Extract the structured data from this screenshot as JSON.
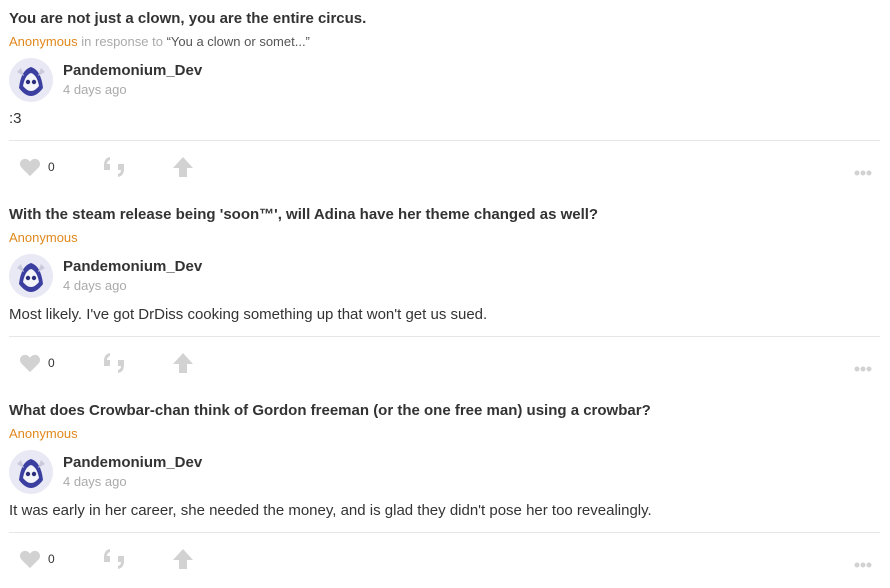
{
  "posts": [
    {
      "question": "You are not just a clown, you are the entire circus.",
      "asker": "Anonymous",
      "in_response_to": "in response to",
      "quote": "“You a clown or somet...”",
      "author": "Pandemonium_Dev",
      "time": "4 days ago",
      "answer": ":3",
      "likes": "0"
    },
    {
      "question": "With the steam release being 'soon™', will Adina have her theme changed as well?",
      "asker": "Anonymous",
      "author": "Pandemonium_Dev",
      "time": "4 days ago",
      "answer": "Most likely. I've got DrDiss cooking something up that won't get us sued.",
      "likes": "0"
    },
    {
      "question": "What does Crowbar-chan think of Gordon freeman (or the one free man) using a crowbar?",
      "asker": "Anonymous",
      "author": "Pandemonium_Dev",
      "time": "4 days ago",
      "answer": "It was early in her career, she needed the money, and is glad they didn't pose her too revealingly.",
      "likes": "0"
    }
  ],
  "icons": {
    "like": "heart-icon",
    "quote": "quote-icon",
    "share": "arrow-up-icon",
    "more": "more-dots-icon"
  },
  "colors": {
    "accent": "#e0881d",
    "muted": "#aaaaaa",
    "icon": "#d2d2d2",
    "text": "#333333"
  }
}
